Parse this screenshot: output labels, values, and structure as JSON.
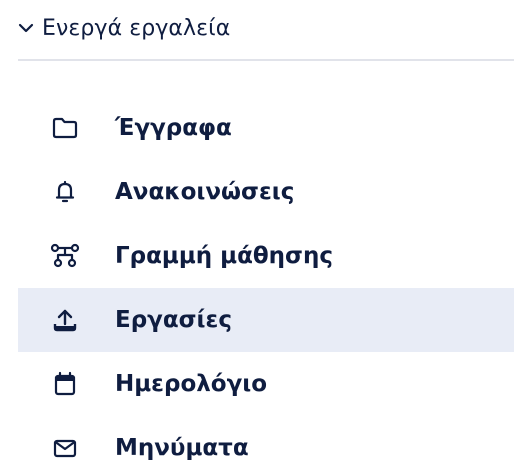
{
  "section": {
    "title": "Ενεργά εργαλεία",
    "chevron_icon": "chevron-down-icon",
    "expanded": true
  },
  "tools": {
    "items": [
      {
        "label": "Έγγραφα",
        "icon": "folder-icon",
        "active": false
      },
      {
        "label": "Ανακοινώσεις",
        "icon": "bell-icon",
        "active": false
      },
      {
        "label": "Γραμμή μάθησης",
        "icon": "learning-path-icon",
        "active": false
      },
      {
        "label": "Εργασίες",
        "icon": "upload-icon",
        "active": true
      },
      {
        "label": "Ημερολόγιο",
        "icon": "calendar-icon",
        "active": false
      },
      {
        "label": "Μηνύματα",
        "icon": "envelope-icon",
        "active": false
      }
    ]
  },
  "colors": {
    "text": "#0f1d40",
    "active_bg": "#e8ecf6",
    "divider": "#e1e3ea"
  }
}
